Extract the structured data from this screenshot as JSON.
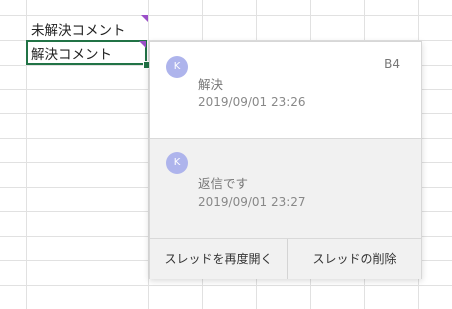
{
  "sheet": {
    "cells": {
      "a1": "未解決コメント",
      "a2": "解決コメント"
    }
  },
  "comment_pane": {
    "cell_ref": "B4",
    "thread": {
      "avatar_initial": "K",
      "text": "解決",
      "timestamp": "2019/09/01 23:26"
    },
    "reply": {
      "avatar_initial": "K",
      "text": "返信です",
      "timestamp": "2019/09/01 23:27"
    },
    "actions": {
      "reopen_label": "スレッドを再度開く",
      "delete_label": "スレッドの削除"
    }
  },
  "colors": {
    "selection": "#217346",
    "comment_flag": "#9b4fc8",
    "avatar": "#aeb4ec"
  }
}
